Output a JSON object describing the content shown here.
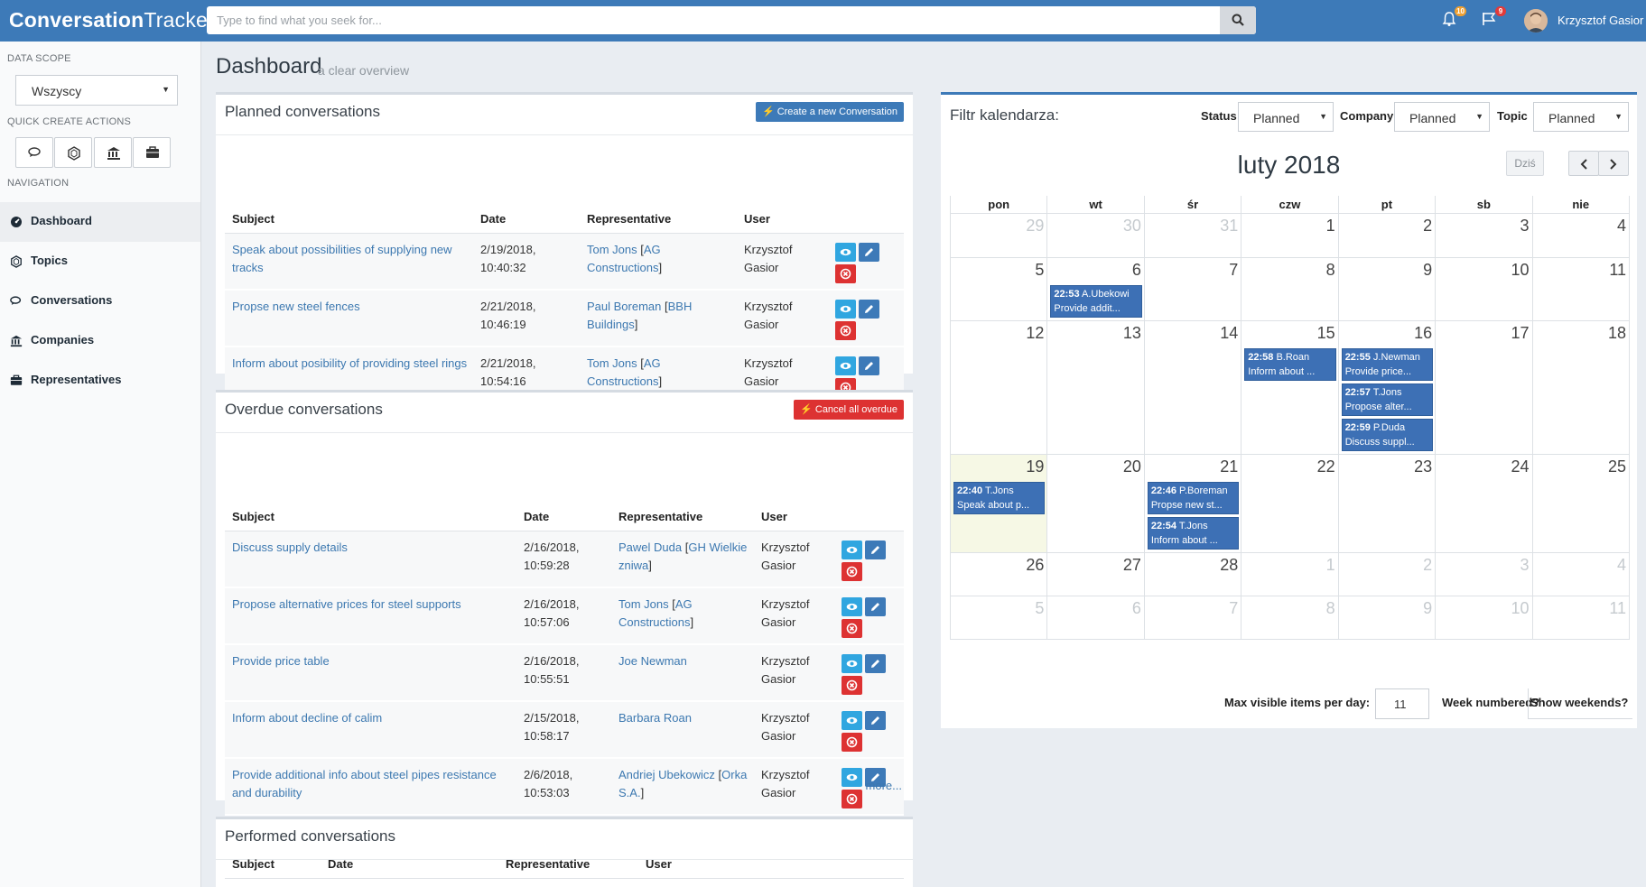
{
  "brand": {
    "bold": "Conversation",
    "thin": "Tracker"
  },
  "search": {
    "placeholder": "Type to find what you seek for..."
  },
  "notifications": {
    "bell_count": "10",
    "flag_count": "9"
  },
  "user": {
    "name": "Krzysztof Gasior"
  },
  "sidebar": {
    "data_scope_label": "DATA SCOPE",
    "data_scope_value": "Wszyscy",
    "quick_actions_label": "QUICK CREATE ACTIONS",
    "navigation_label": "NAVIGATION",
    "nav": [
      {
        "label": "Dashboard",
        "icon": "dashboard-icon"
      },
      {
        "label": "Topics",
        "icon": "topics-icon"
      },
      {
        "label": "Conversations",
        "icon": "conversations-icon"
      },
      {
        "label": "Companies",
        "icon": "bank-icon"
      },
      {
        "label": "Representatives",
        "icon": "briefcase-icon"
      }
    ]
  },
  "page": {
    "title": "Dashboard",
    "subtitle": "a clear overview"
  },
  "planned": {
    "title": "Planned conversations",
    "create_label": "Create a new Conversation",
    "headers": [
      "Subject",
      "Date",
      "Representative",
      "User"
    ],
    "rows": [
      {
        "subject": "Speak about possibilities of supplying new tracks",
        "date": "2/19/2018, 10:40:32",
        "rep_name": "Tom Jons",
        "rep_company": "AG Constructions",
        "user": "Krzysztof Gasior"
      },
      {
        "subject": "Propse new steel fences",
        "date": "2/21/2018, 10:46:19",
        "rep_name": "Paul Boreman",
        "rep_company": "BBH Buildings",
        "user": "Krzysztof Gasior"
      },
      {
        "subject": "Inform about posibility of providing steel rings",
        "date": "2/21/2018, 10:54:16",
        "rep_name": "Tom Jons",
        "rep_company": "AG Constructions",
        "user": "Krzysztof Gasior"
      }
    ]
  },
  "overdue": {
    "title": "Overdue conversations",
    "cancel_label": "Cancel all overdue",
    "headers": [
      "Subject",
      "Date",
      "Representative",
      "User"
    ],
    "rows": [
      {
        "subject": "Discuss supply details",
        "date": "2/16/2018, 10:59:28",
        "rep_name": "Pawel Duda",
        "rep_company": "GH Wielkie zniwa",
        "user": "Krzysztof Gasior"
      },
      {
        "subject": "Propose alternative prices for steel supports",
        "date": "2/16/2018, 10:57:06",
        "rep_name": "Tom Jons",
        "rep_company": "AG Constructions",
        "user": "Krzysztof Gasior"
      },
      {
        "subject": "Provide price table",
        "date": "2/16/2018, 10:55:51",
        "rep_name": "Joe Newman",
        "rep_company": "",
        "user": "Krzysztof Gasior"
      },
      {
        "subject": "Inform about decline of calim",
        "date": "2/15/2018, 10:58:17",
        "rep_name": "Barbara Roan",
        "rep_company": "",
        "user": "Krzysztof Gasior"
      },
      {
        "subject": "Provide additional info about steel pipes resistance and durability",
        "date": "2/6/2018, 10:53:03",
        "rep_name": "Andriej Ubekowicz",
        "rep_company": "Orka S.A.",
        "user": "Krzysztof Gasior"
      }
    ],
    "more_label": "more..."
  },
  "performed": {
    "title": "Performed conversations",
    "headers": [
      "Subject",
      "Date",
      "Representative",
      "User"
    ]
  },
  "calendar": {
    "filter_title": "Filtr kalendarza:",
    "filters": [
      {
        "label": "Status",
        "value": "Planned"
      },
      {
        "label": "Company",
        "value": "Planned"
      },
      {
        "label": "Topic",
        "value": "Planned"
      }
    ],
    "month": "luty 2018",
    "today_label": "Dziś",
    "weekdays": [
      "pon",
      "wt",
      "śr",
      "czw",
      "pt",
      "sb",
      "nie"
    ],
    "weeks": [
      [
        {
          "d": "29",
          "o": true
        },
        {
          "d": "30",
          "o": true
        },
        {
          "d": "31",
          "o": true
        },
        {
          "d": "1"
        },
        {
          "d": "2"
        },
        {
          "d": "3"
        },
        {
          "d": "4"
        }
      ],
      [
        {
          "d": "5"
        },
        {
          "d": "6",
          "ev": [
            {
              "t": "22:53",
              "n": "A.Ubekowi",
              "s": "Provide addit..."
            }
          ]
        },
        {
          "d": "7"
        },
        {
          "d": "8"
        },
        {
          "d": "9"
        },
        {
          "d": "10"
        },
        {
          "d": "11"
        }
      ],
      [
        {
          "d": "12"
        },
        {
          "d": "13"
        },
        {
          "d": "14"
        },
        {
          "d": "15",
          "ev": [
            {
              "t": "22:58",
              "n": "B.Roan",
              "s": "Inform about ..."
            }
          ]
        },
        {
          "d": "16",
          "ev": [
            {
              "t": "22:55",
              "n": "J.Newman",
              "s": "Provide price..."
            },
            {
              "t": "22:57",
              "n": "T.Jons",
              "s": "Propose alter..."
            },
            {
              "t": "22:59",
              "n": "P.Duda",
              "s": "Discuss suppl..."
            }
          ]
        },
        {
          "d": "17"
        },
        {
          "d": "18"
        }
      ],
      [
        {
          "d": "19",
          "today": true,
          "ev": [
            {
              "t": "22:40",
              "n": "T.Jons",
              "s": "Speak about p..."
            }
          ]
        },
        {
          "d": "20"
        },
        {
          "d": "21",
          "ev": [
            {
              "t": "22:46",
              "n": "P.Boreman",
              "s": "Propse new st..."
            },
            {
              "t": "22:54",
              "n": "T.Jons",
              "s": "Inform about ..."
            }
          ]
        },
        {
          "d": "22"
        },
        {
          "d": "23"
        },
        {
          "d": "24"
        },
        {
          "d": "25"
        }
      ],
      [
        {
          "d": "26"
        },
        {
          "d": "27"
        },
        {
          "d": "28"
        },
        {
          "d": "1",
          "o": true
        },
        {
          "d": "2",
          "o": true
        },
        {
          "d": "3",
          "o": true
        },
        {
          "d": "4",
          "o": true
        }
      ],
      [
        {
          "d": "5",
          "o": true
        },
        {
          "d": "6",
          "o": true
        },
        {
          "d": "7",
          "o": true
        },
        {
          "d": "8",
          "o": true
        },
        {
          "d": "9",
          "o": true
        },
        {
          "d": "10",
          "o": true
        },
        {
          "d": "11",
          "o": true
        }
      ]
    ],
    "max_items_label": "Max visible items per day:",
    "max_items_value": "11",
    "week_numbered_label": "Week numbered?",
    "show_weekends_label": "Show weekends?"
  }
}
